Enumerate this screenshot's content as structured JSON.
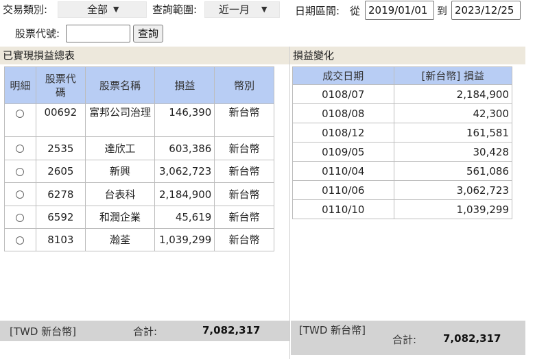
{
  "filters": {
    "trade_type_label": "交易類別:",
    "trade_type_value": "全部",
    "range_label": "查詢範圍:",
    "range_value": "近一月",
    "date_range_label": "日期區間:",
    "from_label": "從",
    "from_date": "2019/01/01",
    "to_label": "到",
    "to_date": "2023/12/25",
    "stock_code_label": "股票代號:",
    "stock_code_value": "",
    "query_button": "查詢"
  },
  "summary_panel": {
    "title": "已實現損益總表",
    "headers": [
      "明細",
      "股票代碼",
      "股票名稱",
      "損益",
      "幣別"
    ],
    "rows": [
      {
        "code": "00692",
        "name": "富邦公司治理",
        "pnl": "146,390",
        "currency": "新台幣"
      },
      {
        "code": "2535",
        "name": "達欣工",
        "pnl": "603,386",
        "currency": "新台幣"
      },
      {
        "code": "2605",
        "name": "新興",
        "pnl": "3,062,723",
        "currency": "新台幣"
      },
      {
        "code": "6278",
        "name": "台表科",
        "pnl": "2,184,900",
        "currency": "新台幣"
      },
      {
        "code": "6592",
        "name": "和潤企業",
        "pnl": "45,619",
        "currency": "新台幣"
      },
      {
        "code": "8103",
        "name": "瀚荃",
        "pnl": "1,039,299",
        "currency": "新台幣"
      }
    ],
    "footer": {
      "currency": "[TWD 新台幣]",
      "total_label": "合計:",
      "total_value": "7,082,317"
    }
  },
  "change_panel": {
    "title": "損益變化",
    "headers": [
      "成交日期",
      "[新台幣] 損益"
    ],
    "rows": [
      {
        "date": "0108/07",
        "pnl": "2,184,900"
      },
      {
        "date": "0108/08",
        "pnl": "42,300"
      },
      {
        "date": "0108/12",
        "pnl": "161,581"
      },
      {
        "date": "0109/05",
        "pnl": "30,428"
      },
      {
        "date": "0110/04",
        "pnl": "561,086"
      },
      {
        "date": "0110/06",
        "pnl": "3,062,723"
      },
      {
        "date": "0110/10",
        "pnl": "1,039,299"
      }
    ],
    "footer": {
      "currency": "[TWD 新台幣]",
      "total_label": "合計:",
      "total_value": "7,082,317"
    }
  },
  "icons": {
    "dropdown": "caret-down-icon",
    "radio": "radio-unchecked-icon"
  }
}
